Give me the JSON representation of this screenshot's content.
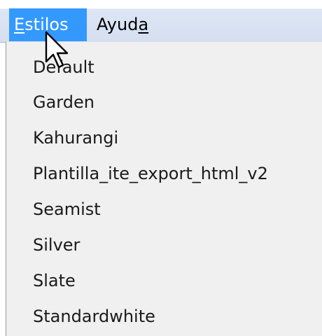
{
  "menubar": {
    "items": [
      {
        "label_before": "",
        "mnemonic": "E",
        "label_after": "stilos",
        "state": "open"
      },
      {
        "label_before": "Ayud",
        "mnemonic": "a",
        "label_after": "",
        "state": "normal"
      }
    ]
  },
  "dropdown": {
    "items": [
      "Default",
      "Garden",
      "Kahurangi",
      "Plantilla_ite_export_html_v2",
      "Seamist",
      "Silver",
      "Slate",
      "Standardwhite"
    ]
  },
  "colors": {
    "highlight": "#3399ff",
    "menu_background": "#f0f0f0",
    "menubar_background": "#d5dff0"
  },
  "cursor": {
    "icon": "mouse-pointer-icon"
  }
}
